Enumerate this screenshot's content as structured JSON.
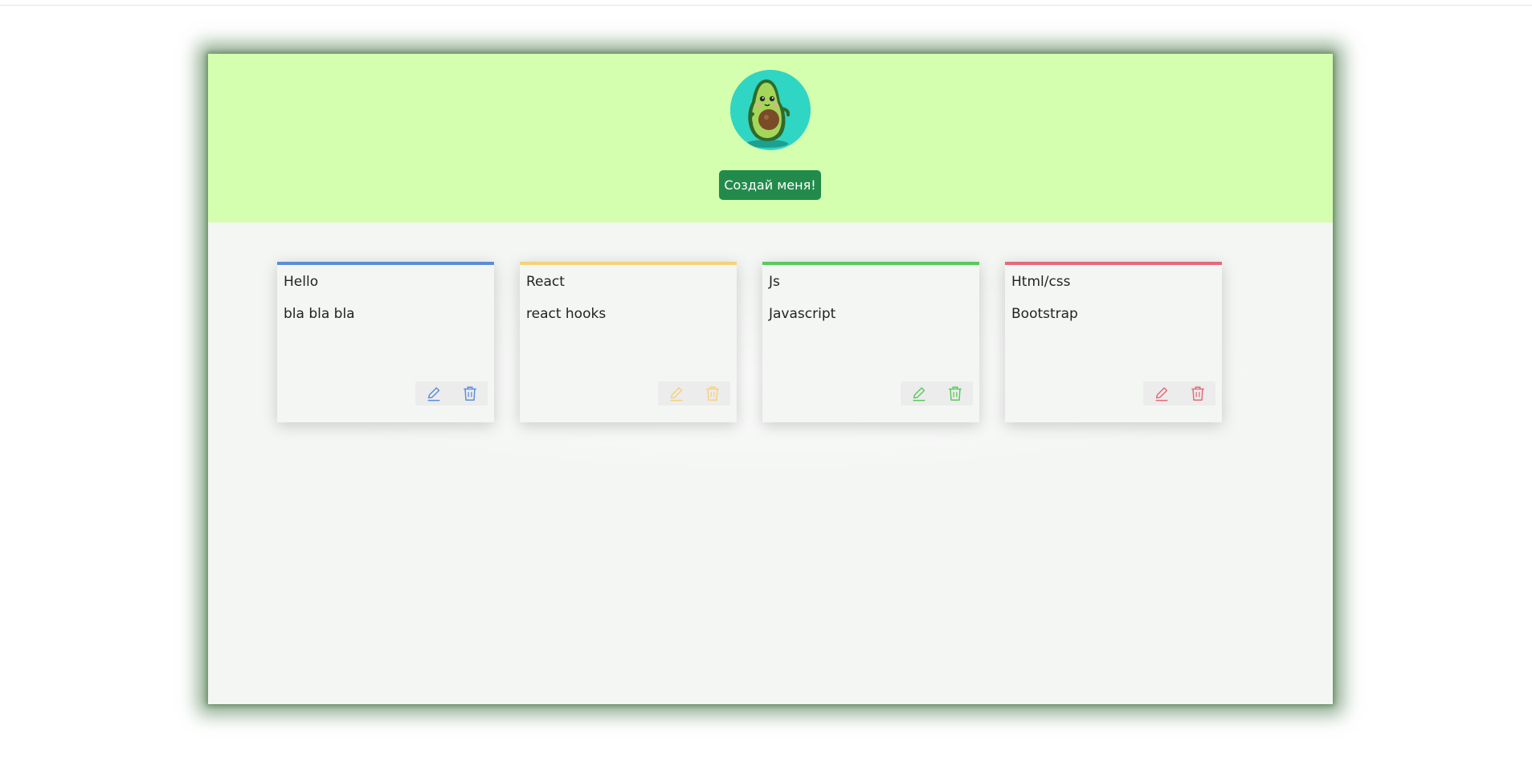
{
  "header": {
    "create_button_label": "Создай меня!"
  },
  "cards": [
    {
      "title": "Hello",
      "body": "bla bla bla",
      "accent": "#5b8dd9"
    },
    {
      "title": "React",
      "body": "react hooks",
      "accent": "#f5d17a"
    },
    {
      "title": "Js",
      "body": "Javascript",
      "accent": "#5bc95b"
    },
    {
      "title": "Html/css",
      "body": "Bootstrap",
      "accent": "#e26a7a"
    }
  ],
  "icons": {
    "edit": "pencil-icon",
    "delete": "trash-icon"
  },
  "colors": {
    "header_bg": "#d4ffae",
    "button_bg": "#228b4c",
    "avatar_bg": "#2fd6c3"
  }
}
